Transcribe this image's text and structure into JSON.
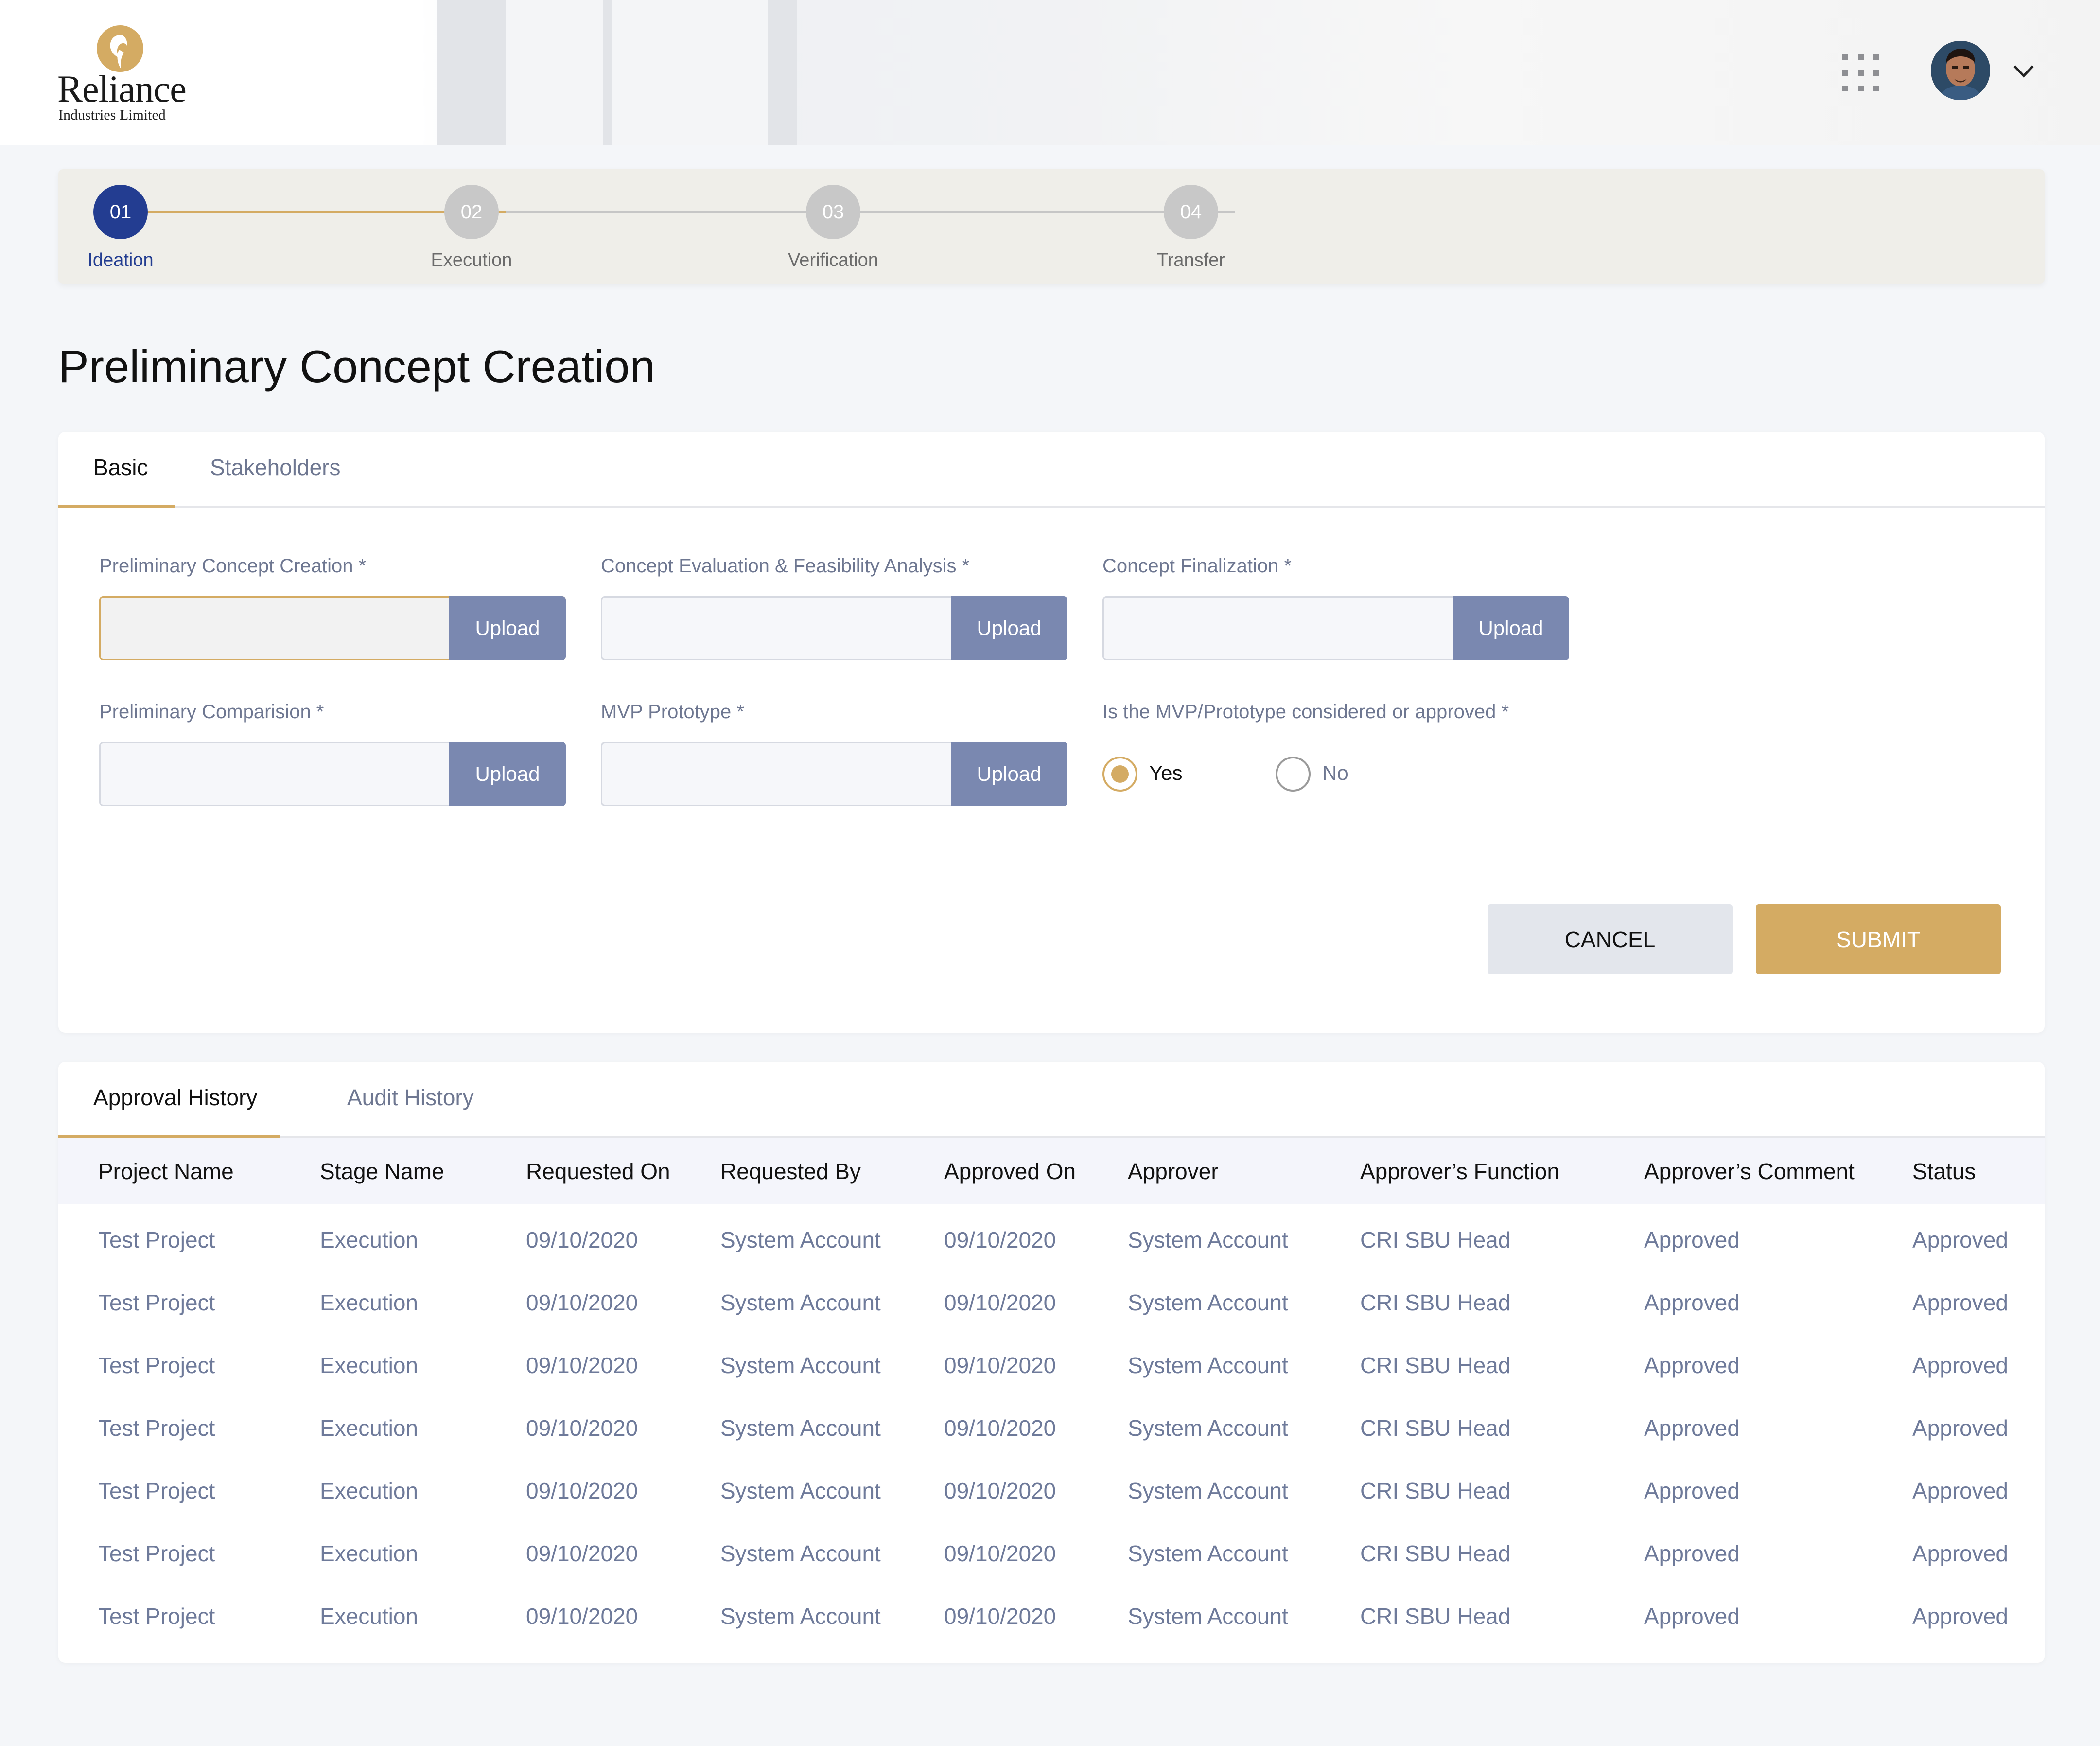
{
  "brand": {
    "name": "Reliance",
    "subtitle": "Industries Limited",
    "gold": "#d4ab63",
    "navy": "#233d91",
    "upload_blue": "#7a88b0"
  },
  "header": {
    "apps_icon": "grid-apps-icon",
    "user_menu_icon": "chevron-down-icon"
  },
  "stepper": {
    "steps": [
      {
        "number": "01",
        "label": "Ideation",
        "state": "active"
      },
      {
        "number": "02",
        "label": "Execution",
        "state": "inactive"
      },
      {
        "number": "03",
        "label": "Verification",
        "state": "inactive"
      },
      {
        "number": "04",
        "label": "Transfer",
        "state": "inactive"
      }
    ]
  },
  "page": {
    "title": "Preliminary Concept Creation"
  },
  "form": {
    "tabs": [
      {
        "label": "Basic",
        "active": true
      },
      {
        "label": "Stakeholders",
        "active": false
      }
    ],
    "fields": [
      {
        "label": "Preliminary Concept Creation *",
        "button": "Upload",
        "value": ""
      },
      {
        "label": "Concept Evaluation & Feasibility Analysis *",
        "button": "Upload",
        "value": ""
      },
      {
        "label": "Concept Finalization *",
        "button": "Upload",
        "value": ""
      },
      {
        "label": "Preliminary Comparision *",
        "button": "Upload",
        "value": ""
      },
      {
        "label": "MVP Prototype *",
        "button": "Upload",
        "value": ""
      }
    ],
    "radio_question": "Is the MVP/Prototype considered or approved *",
    "radio_options": [
      {
        "label": "Yes",
        "selected": true
      },
      {
        "label": "No",
        "selected": false
      }
    ],
    "cancel_label": "CANCEL",
    "submit_label": "SUBMIT"
  },
  "history": {
    "tabs": [
      {
        "label": "Approval History",
        "active": true
      },
      {
        "label": "Audit History",
        "active": false
      }
    ],
    "columns": [
      "Project Name",
      "Stage Name",
      "Requested On",
      "Requested By",
      "Approved On",
      "Approver",
      "Approver’s Function",
      "Approver’s Comment",
      "Status"
    ],
    "rows": [
      [
        "Test Project",
        "Execution",
        "09/10/2020",
        "System Account",
        "09/10/2020",
        "System Account",
        "CRI SBU Head",
        "Approved",
        "Approved"
      ],
      [
        "Test Project",
        "Execution",
        "09/10/2020",
        "System Account",
        "09/10/2020",
        "System Account",
        "CRI SBU Head",
        "Approved",
        "Approved"
      ],
      [
        "Test Project",
        "Execution",
        "09/10/2020",
        "System Account",
        "09/10/2020",
        "System Account",
        "CRI SBU Head",
        "Approved",
        "Approved"
      ],
      [
        "Test Project",
        "Execution",
        "09/10/2020",
        "System Account",
        "09/10/2020",
        "System Account",
        "CRI SBU Head",
        "Approved",
        "Approved"
      ],
      [
        "Test Project",
        "Execution",
        "09/10/2020",
        "System Account",
        "09/10/2020",
        "System Account",
        "CRI SBU Head",
        "Approved",
        "Approved"
      ],
      [
        "Test Project",
        "Execution",
        "09/10/2020",
        "System Account",
        "09/10/2020",
        "System Account",
        "CRI SBU Head",
        "Approved",
        "Approved"
      ],
      [
        "Test Project",
        "Execution",
        "09/10/2020",
        "System Account",
        "09/10/2020",
        "System Account",
        "CRI SBU Head",
        "Approved",
        "Approved"
      ]
    ]
  }
}
